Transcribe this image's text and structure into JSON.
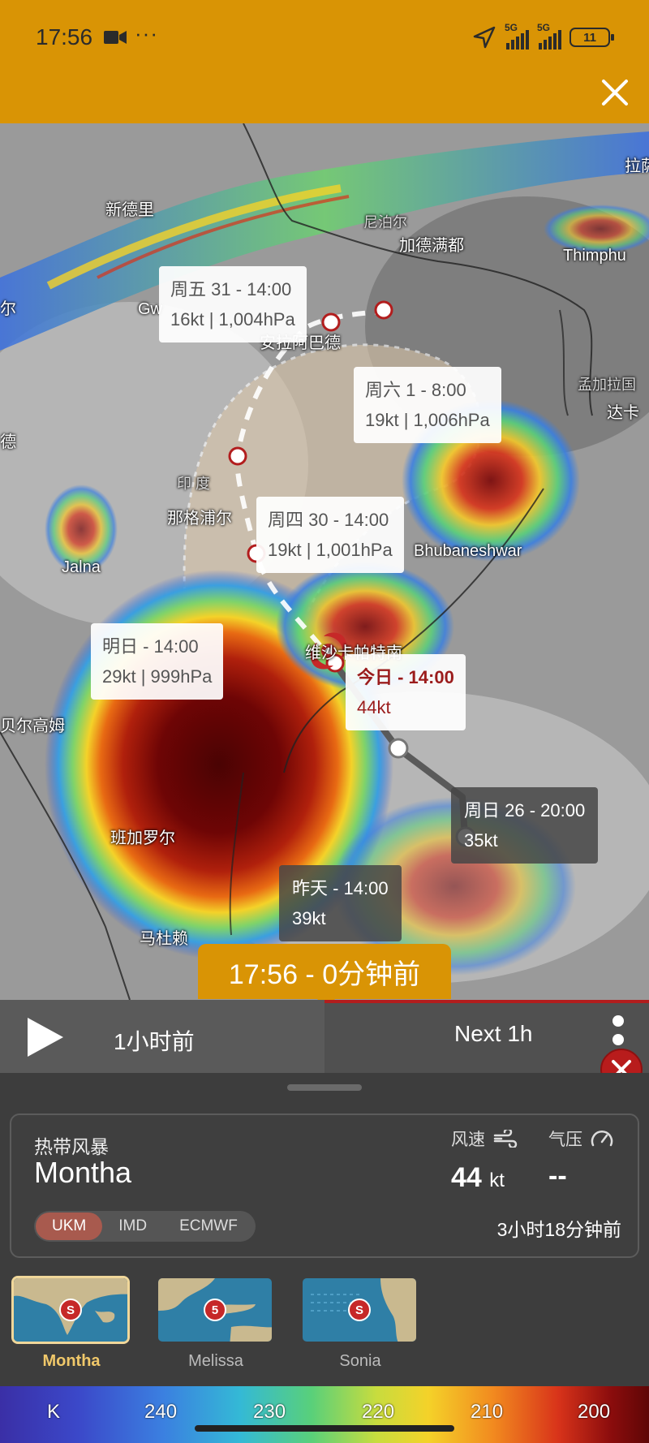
{
  "status_bar": {
    "time": "17:56",
    "battery": "11",
    "signal_1": "5G",
    "signal_2": "5G"
  },
  "map": {
    "places": {
      "new_delhi": "新德里",
      "nepal": "尼泊尔",
      "kathmandu": "加德满都",
      "thimphu": "Thimphu",
      "lhasa": "拉萨",
      "bangladesh": "孟加拉国",
      "dhaka": "达卡",
      "gwalior": "Gw",
      "allahabad": "安拉阿巴德",
      "india": "印 度",
      "nagpur": "那格浦尔",
      "jalna": "Jalna",
      "bhubaneswar": "Bhubaneshwar",
      "visakhapatnam": "维沙卡帕特南",
      "belgaum": "贝尔高姆",
      "bangalore": "班加罗尔",
      "madurai": "马杜赖",
      "left_edge_1": "尔",
      "left_edge_2": "德"
    },
    "forecast_points": [
      {
        "title": "周五 31 - 14:00",
        "detail": "16kt | 1,004hPa"
      },
      {
        "title": "周六 1 - 8:00",
        "detail": "19kt | 1,006hPa"
      },
      {
        "title": "周四 30 - 14:00",
        "detail": "19kt | 1,001hPa"
      },
      {
        "title": "明日 - 14:00",
        "detail": "29kt | 999hPa"
      },
      {
        "title": "今日 - 14:00",
        "detail": "44kt"
      }
    ],
    "past_points": [
      {
        "title": "周日 26 - 20:00",
        "detail": "35kt"
      },
      {
        "title": "昨天 - 14:00",
        "detail": "39kt"
      }
    ],
    "current_time_badge": "17:56 - 0分钟前"
  },
  "timeline": {
    "past_label": "1小时前",
    "next_label": "Next 1h"
  },
  "storm_panel": {
    "type": "热带风暴",
    "name": "Montha",
    "wind_label": "风速",
    "wind_value": "44",
    "wind_unit": "kt",
    "pressure_label": "气压",
    "pressure_value": "--",
    "models": [
      "UKM",
      "IMD",
      "ECMWF"
    ],
    "active_model": "UKM",
    "updated": "3小时18分钟前"
  },
  "storms": [
    {
      "name": "Montha",
      "badge": "S",
      "active": true
    },
    {
      "name": "Melissa",
      "badge": "5",
      "active": false
    },
    {
      "name": "Sonia",
      "badge": "S",
      "active": false
    }
  ],
  "legend": {
    "unit": "K",
    "ticks": [
      "240",
      "230",
      "220",
      "210",
      "200"
    ]
  },
  "colors": {
    "accent": "#d99405",
    "storm_red": "#c62828",
    "active_model": "#a85a4e"
  }
}
